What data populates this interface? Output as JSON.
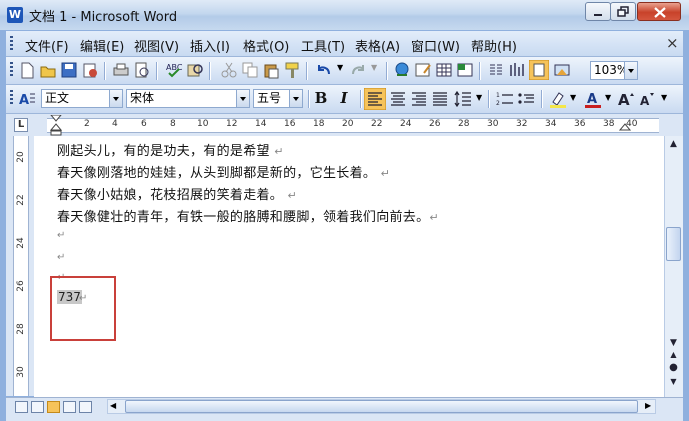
{
  "window": {
    "title": "文档 1 - Microsoft Word",
    "app_icon": "W"
  },
  "menu": {
    "items": [
      "文件(F)",
      "编辑(E)",
      "视图(V)",
      "插入(I)",
      "格式(O)",
      "工具(T)",
      "表格(A)",
      "窗口(W)",
      "帮助(H)"
    ],
    "close_glyph": "×"
  },
  "toolbar": {
    "zoom": "103%",
    "style": "正文",
    "font": "宋体",
    "size": "五号",
    "bold": "B",
    "italic": "I"
  },
  "ruler": {
    "corner": "L",
    "h_marks": [
      "2",
      "4",
      "6",
      "8",
      "10",
      "12",
      "14",
      "16",
      "18",
      "20",
      "22",
      "24",
      "26",
      "28",
      "30",
      "32",
      "34",
      "36",
      "38",
      "40"
    ],
    "v_marks": [
      "20",
      "22",
      "24",
      "26",
      "28",
      "30"
    ]
  },
  "document": {
    "lines": [
      "刚起头儿，有的是功夫，有的是希望",
      "春天像刚落地的娃娃，从头到脚都是新的，它生长着。",
      "春天像小姑娘，花枝招展的笑着走着。",
      "春天像健壮的青年，有铁一般的胳膊和腰脚，领着我们向前去。"
    ],
    "pilcrow": "↵",
    "selected_text": "737"
  },
  "colors": {
    "highlight_box": "#c9403a",
    "selection": "#c8c8c8"
  }
}
